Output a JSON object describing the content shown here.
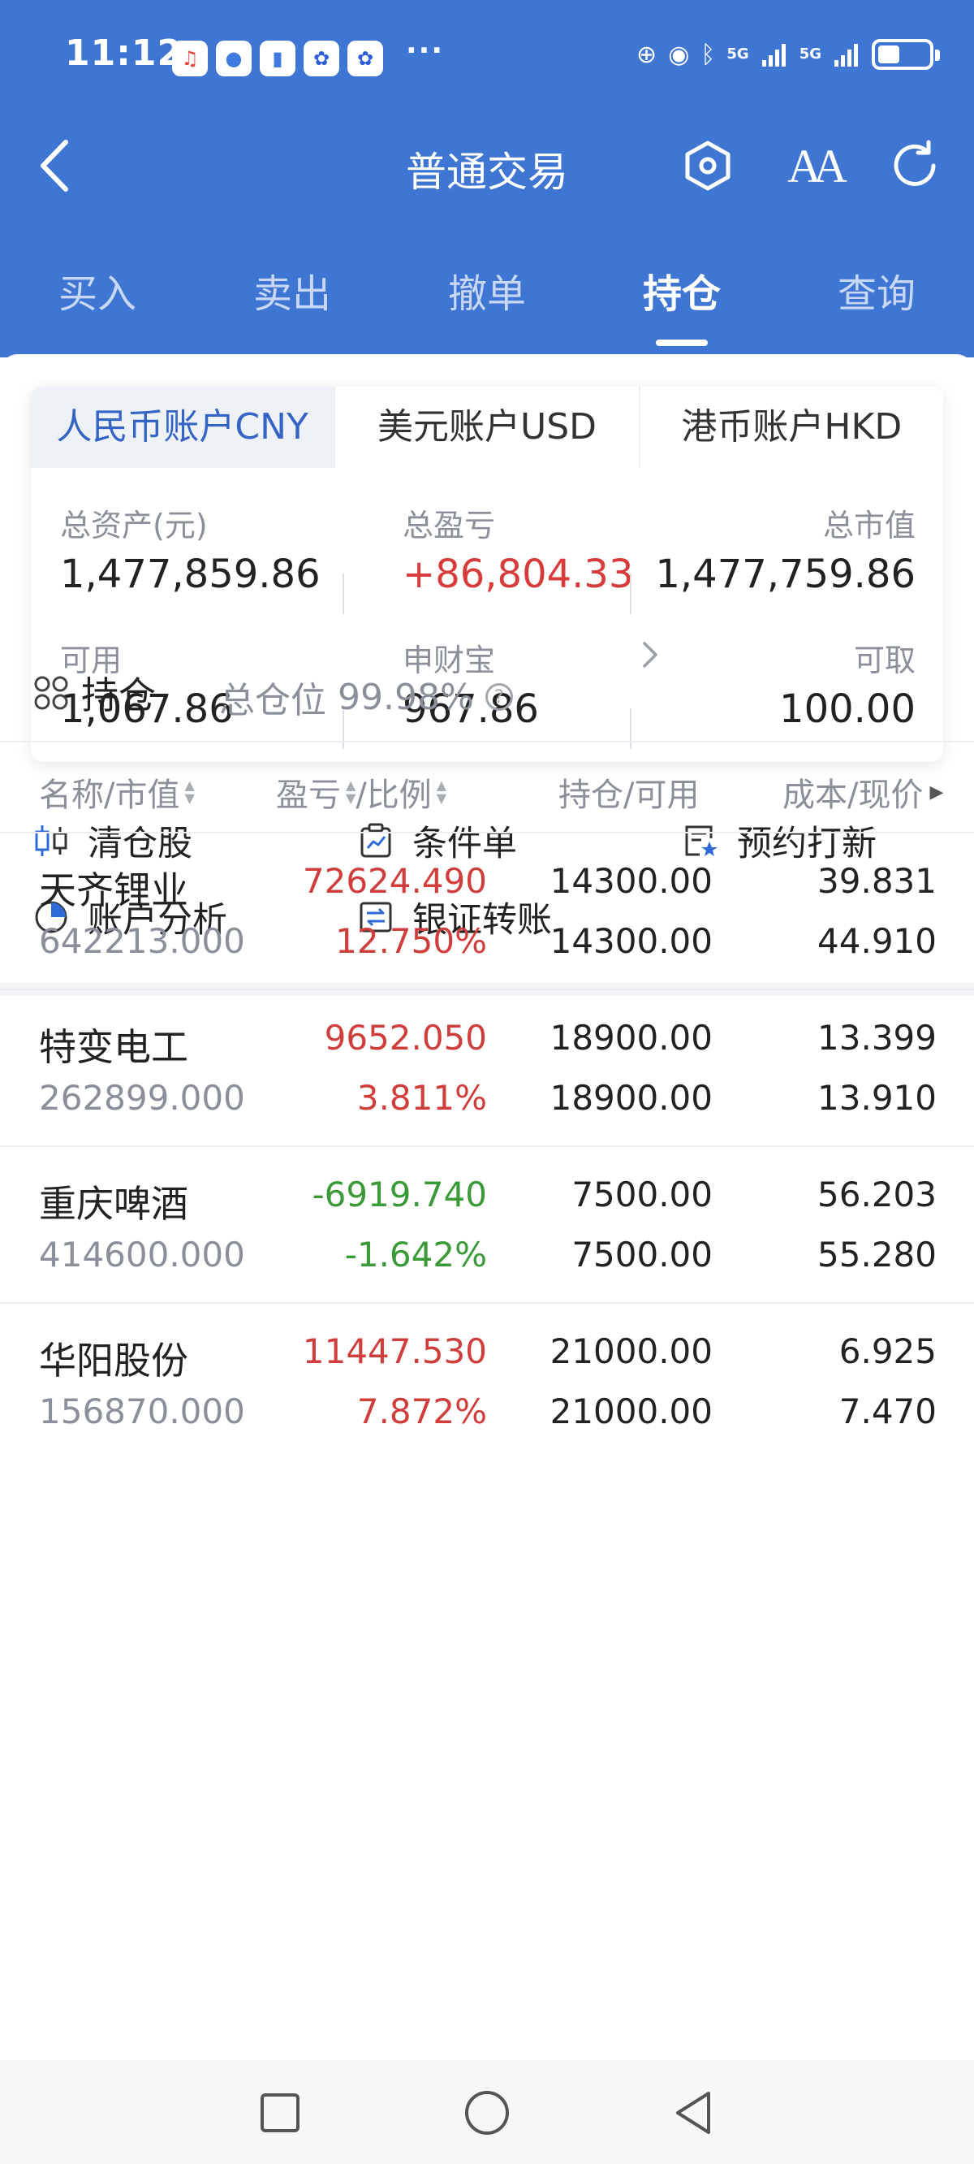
{
  "status_bar": {
    "time": "11:12",
    "notification_icons": [
      "music-icon",
      "chat-icon",
      "shield-icon",
      "baidu-paw-icon",
      "baidu-paw-icon"
    ],
    "more": "···",
    "network_1": "5G",
    "network_2": "5G",
    "battery_level": 0.3
  },
  "titlebar": {
    "title": "普通交易",
    "font_button": "AA"
  },
  "tabs": [
    {
      "label": "买入",
      "active": false
    },
    {
      "label": "卖出",
      "active": false
    },
    {
      "label": "撤单",
      "active": false
    },
    {
      "label": "持仓",
      "active": true
    },
    {
      "label": "查询",
      "active": false
    }
  ],
  "account": {
    "tabs": [
      "人民币账户CNY",
      "美元账户USD",
      "港币账户HKD"
    ],
    "active_tab": 0,
    "total_assets_label": "总资产(元)",
    "total_assets": "1,477,859.86",
    "total_pl_label": "总盈亏",
    "total_pl": "+86,804.33",
    "market_value_label": "总市值",
    "market_value": "1,477,759.86",
    "available_label": "可用",
    "available": "1,067.86",
    "scb_label": "申财宝",
    "scb_value": "967.86",
    "withdrawable_label": "可取",
    "withdrawable": "100.00"
  },
  "quick_actions": [
    {
      "label": "清仓股",
      "icon": "candlestick-icon"
    },
    {
      "label": "条件单",
      "icon": "clipboard-chart-icon"
    },
    {
      "label": "预约打新",
      "icon": "star-doc-icon"
    },
    {
      "label": "账户分析",
      "icon": "pie-chart-icon"
    },
    {
      "label": "银证转账",
      "icon": "transfer-icon"
    }
  ],
  "positions": {
    "title": "持仓",
    "ratio_label": "总仓位",
    "ratio_value": "99.98%",
    "help": "?",
    "columns": {
      "name": "名称/市值",
      "pl": "盈亏",
      "ratio": "/比例",
      "hold": "持仓/可用",
      "cost": "成本/现价"
    },
    "rows": [
      {
        "name": "天齐锂业",
        "market_value": "642213.000",
        "pl": "72624.490",
        "ratio": "12.750%",
        "hold": "14300.00",
        "available": "14300.00",
        "cost": "39.831",
        "price": "44.910",
        "trend": "up"
      },
      {
        "name": "特变电工",
        "market_value": "262899.000",
        "pl": "9652.050",
        "ratio": "3.811%",
        "hold": "18900.00",
        "available": "18900.00",
        "cost": "13.399",
        "price": "13.910",
        "trend": "up"
      },
      {
        "name": "重庆啤酒",
        "market_value": "414600.000",
        "pl": "-6919.740",
        "ratio": "-1.642%",
        "hold": "7500.00",
        "available": "7500.00",
        "cost": "56.203",
        "price": "55.280",
        "trend": "down"
      },
      {
        "name": "华阳股份",
        "market_value": "156870.000",
        "pl": "11447.530",
        "ratio": "7.872%",
        "hold": "21000.00",
        "available": "21000.00",
        "cost": "6.925",
        "price": "7.470",
        "trend": "up"
      }
    ]
  },
  "colors": {
    "header_blue": "#3f75d3",
    "up_red": "#d03e3c",
    "down_green": "#3a9a37"
  }
}
